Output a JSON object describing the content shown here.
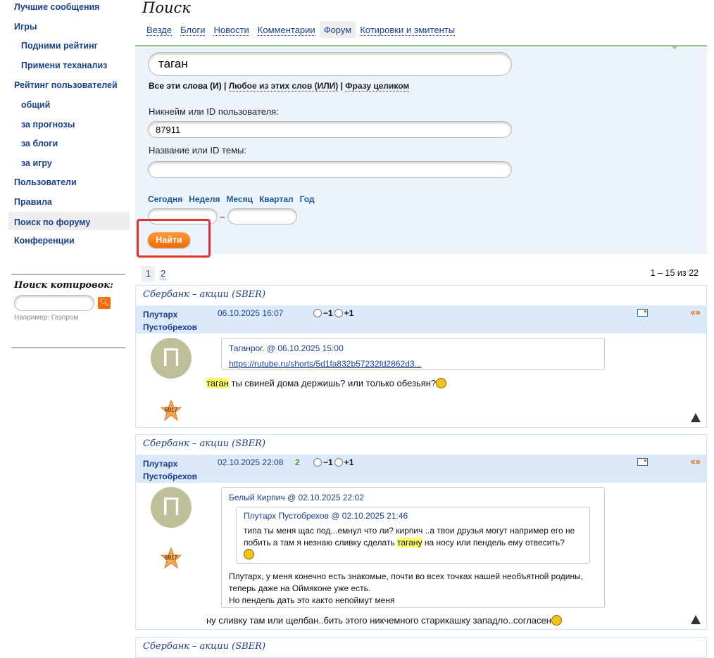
{
  "sidebar": {
    "items": [
      {
        "label": "Лучшие сообщения",
        "sub": false
      },
      {
        "label": "Игры",
        "sub": false
      },
      {
        "label": "Подними рейтинг",
        "sub": true
      },
      {
        "label": "Примени теханализ",
        "sub": true
      },
      {
        "label": "Рейтинг пользователей",
        "sub": false
      },
      {
        "label": "общий",
        "sub": true
      },
      {
        "label": "за прогнозы",
        "sub": true
      },
      {
        "label": "за блоги",
        "sub": true
      },
      {
        "label": "за игру",
        "sub": true
      },
      {
        "label": "Пользователи",
        "sub": false
      },
      {
        "label": "Правила",
        "sub": false
      },
      {
        "label": "Поиск по форуму",
        "sub": false,
        "active": true
      },
      {
        "label": "Конференции",
        "sub": false
      }
    ],
    "quote_search": {
      "title": "Поиск котировок:",
      "value": "",
      "hint": "Например: Газпром"
    }
  },
  "page": {
    "title": "Поиск",
    "tabs": [
      "Везде",
      "Блоги",
      "Новости",
      "Комментарии",
      "Форум",
      "Котировки и эмитенты"
    ],
    "active_tab": "Форум"
  },
  "form": {
    "query": "таган",
    "modes": [
      "Все эти слова (И)",
      "Любое из этих слов (ИЛИ)",
      "Фразу целиком"
    ],
    "nick_label": "Никнейм или ID пользователя:",
    "nick_value": "87911",
    "topic_label": "Название или ID темы:",
    "topic_value": "",
    "periods": [
      "Сегодня",
      "Неделя",
      "Месяц",
      "Квартал",
      "Год"
    ],
    "date_from": "",
    "date_to": "",
    "dash": "–",
    "submit": "Найти"
  },
  "pagination": {
    "pages": [
      "1",
      "2"
    ],
    "current": "1",
    "range": "1 – 15 из 22"
  },
  "posts": [
    {
      "topic": "Сбербанк – акции (SBER)",
      "author1": "Плутарх",
      "author2": "Пустобрехов",
      "date": "06.10.2025 16:07",
      "score": "",
      "minus": "−1",
      "plus": "+1",
      "quote_icon": "«»",
      "avatar_letter": "П",
      "rating": "6917",
      "quote_head": "Таганрог. @ 06.10.2025 15:00",
      "quote_link": "https://rutube.ru/shorts/5d1fa832b57232fd2862d3...",
      "text_mark": "таган",
      "text_rest": " ты свиней дома держишь? или только обезьян?"
    },
    {
      "topic": "Сбербанк – акции (SBER)",
      "author1": "Плутарх",
      "author2": "Пустобрехов",
      "date": "02.10.2025 22:08",
      "score": "2",
      "minus": "−1",
      "plus": "+1",
      "quote_icon": "«»",
      "avatar_letter": "П",
      "rating": "6917",
      "quote_head": "Белый Кирпич @ 02.10.2025 22:02",
      "inner_head": "Плутарх Пустобрехов @ 02.10.2025 21:46",
      "inner_text1": "типа ты меня щас под...емнул что ли? кирпич ..а твои друзья могут например его не побить а там я незнаю сливку сделать ",
      "inner_mark": "тагану",
      "inner_text2": " на носу или пендель ему отвесить?",
      "quote_lines": [
        "Плутарх, у меня конечно есть знакомые, почти во всех точках нашей необъятной родины,",
        "теперь даже на Оймяконе уже есть.",
        "Но пендель дать это както непоймут меня"
      ],
      "text": "ну сливку там или щелбан..бить этого никчемного старикашку западло..согласен"
    },
    {
      "topic": "Сбербанк – акции (SBER)"
    }
  ]
}
